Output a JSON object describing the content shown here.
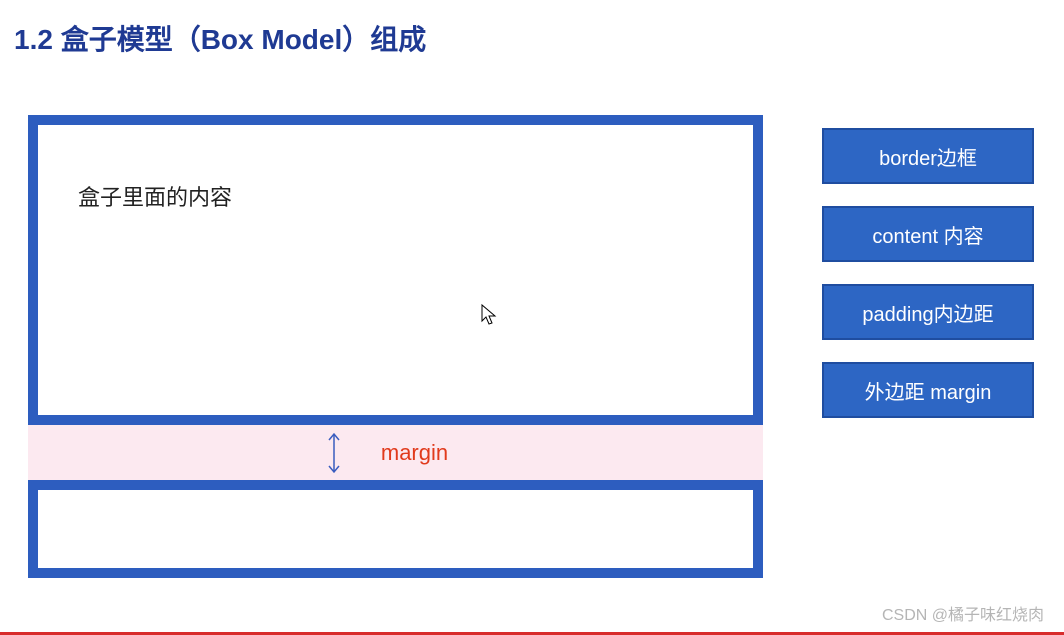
{
  "title": "1.2 盒子模型（Box Model）组成",
  "box": {
    "content_text": "盒子里面的内容",
    "margin_label": "margin"
  },
  "labels": [
    "border边框",
    "content 内容",
    "padding内边距",
    "外边距 margin"
  ],
  "watermark": "CSDN @橘子味红烧肉",
  "colors": {
    "title": "#1f3a93",
    "border": "#2d5dbf",
    "chip_bg": "#2d66c4",
    "margin_strip": "#fce9f0",
    "margin_text": "#e13a1c"
  }
}
